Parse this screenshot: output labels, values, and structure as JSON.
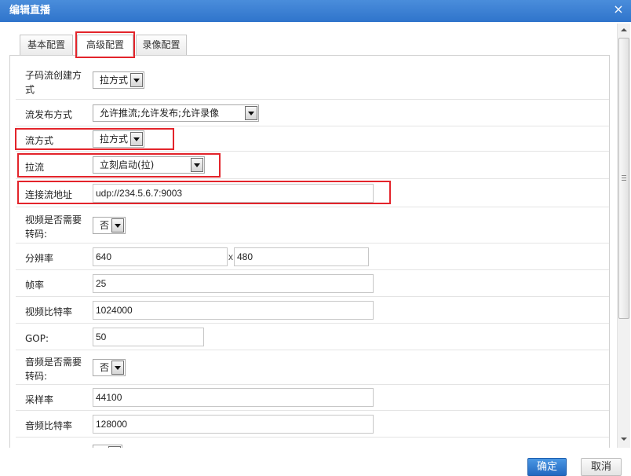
{
  "dialog": {
    "title": "编辑直播",
    "close_glyph": "×"
  },
  "tabs": [
    {
      "label": "基本配置",
      "active": false
    },
    {
      "label": "高级配置",
      "active": true
    },
    {
      "label": "录像配置",
      "active": false
    }
  ],
  "form": {
    "sub_stream_mode": {
      "label": "子码流创建方式",
      "value": "拉方式"
    },
    "publish_mode": {
      "label": "流发布方式",
      "value": "允许推流;允许发布;允许录像"
    },
    "stream_mode": {
      "label": "流方式",
      "value": "拉方式"
    },
    "pull": {
      "label": "拉流",
      "value": "立刻启动(拉)"
    },
    "source_url": {
      "label": "连接流地址",
      "value": "udp://234.5.6.7:9003"
    },
    "video_transcode": {
      "label": "视频是否需要转码:",
      "value": "否"
    },
    "resolution": {
      "label": "分辨率",
      "values": [
        "640",
        "480"
      ],
      "separator": "x"
    },
    "frame_rate": {
      "label": "帧率",
      "value": "25"
    },
    "video_bitrate": {
      "label": "视频比特率",
      "value": "1024000"
    },
    "gop": {
      "label": "GOP:",
      "value": "50"
    },
    "audio_transcode": {
      "label": "音频是否需要转码:",
      "value": "否"
    },
    "sample_rate": {
      "label": "采样率",
      "value": "44100"
    },
    "audio_bitrate": {
      "label": "音频比特率",
      "value": "128000"
    }
  },
  "scrollbar": {
    "scroll_position_percent": 0
  },
  "footer": {
    "confirm_label": "确定",
    "cancel_label": "取消"
  },
  "colors": {
    "title_bar_top": "#4a8ddb",
    "title_bar_bottom": "#2f74cb",
    "highlight": "#e3242b",
    "primary_top": "#4b97e4",
    "primary_bottom": "#2268c0"
  },
  "icons": {
    "close": "close-icon",
    "dropdown": "caret-down-icon",
    "scroll_up": "scroll-up-arrow-icon",
    "scroll_down": "scroll-down-arrow-icon",
    "scroll_grip": "grip-lines-icon"
  }
}
